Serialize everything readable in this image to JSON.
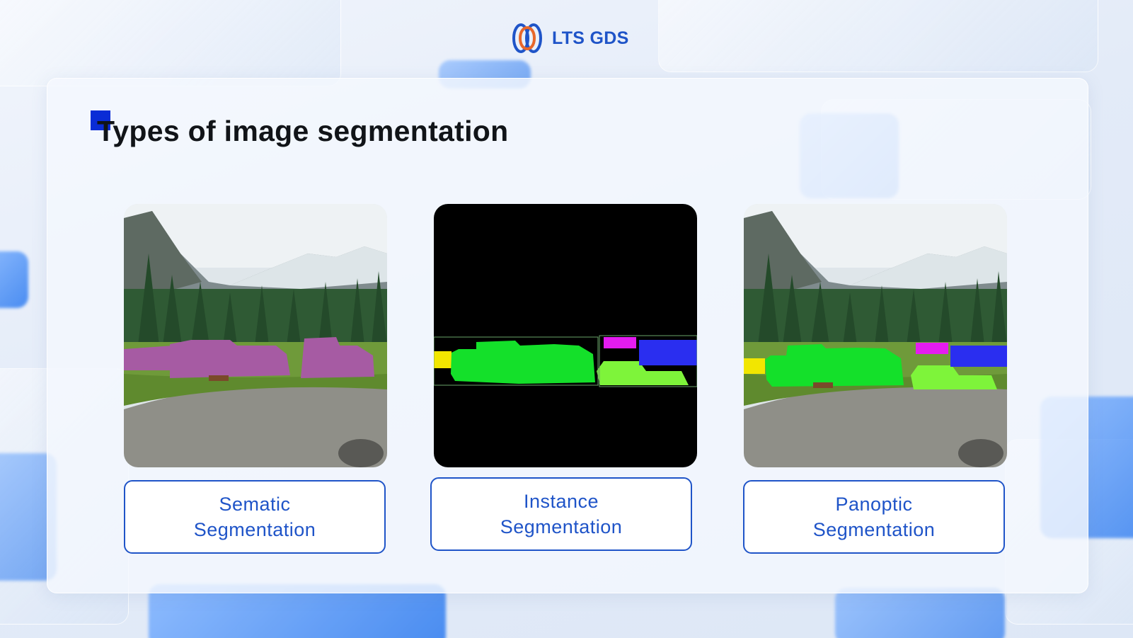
{
  "brand": {
    "name": "LTS GDS",
    "colors": {
      "primary": "#1f54c8",
      "secondary": "#e8672b",
      "title_mark": "#0a2cd6"
    }
  },
  "slide": {
    "title": "Types of image segmentation"
  },
  "panels": [
    {
      "image": "semantic-segmentation-image",
      "label_line1": "Sematic",
      "label_line2": "Segmentation"
    },
    {
      "image": "instance-segmentation-image",
      "label_line1": "Instance",
      "label_line2": "Segmentation"
    },
    {
      "image": "panoptic-segmentation-image",
      "label_line1": "Panoptic",
      "label_line2": "Segmentation"
    }
  ]
}
